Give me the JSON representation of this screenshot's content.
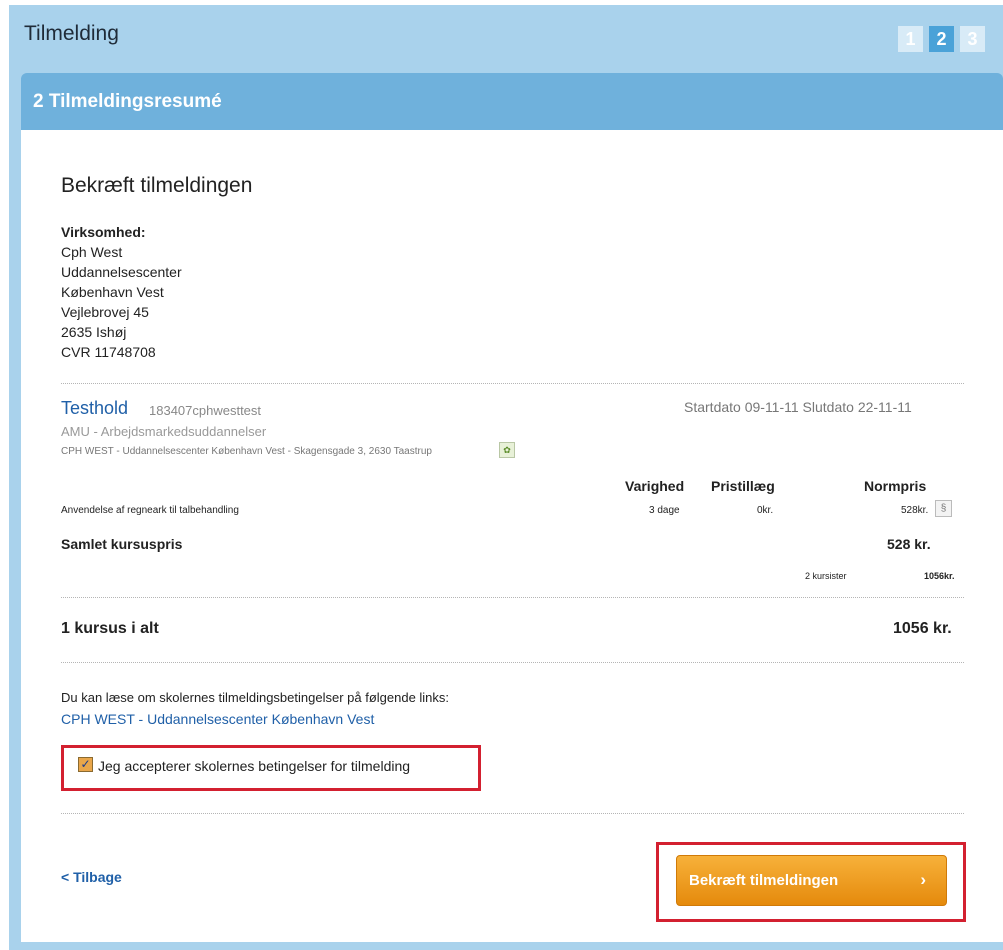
{
  "header": {
    "title": "Tilmelding",
    "steps": [
      "1",
      "2",
      "3"
    ],
    "active_step": 2
  },
  "section": {
    "title": "2 Tilmeldingsresumé"
  },
  "confirm_heading": "Bekræft tilmeldingen",
  "company": {
    "label": "Virksomhed:",
    "lines": [
      "Cph West",
      "Uddannelsescenter",
      "København Vest",
      "Vejlebrovej 45",
      "2635 Ishøj",
      "CVR 11748708"
    ]
  },
  "course": {
    "title": "Testhold",
    "code": "183407cphwesttest",
    "dates": "Startdato 09-11-11 Slutdato 22-11-11",
    "type": "AMU - Arbejdsmarkedsuddannelser",
    "location": "CPH WEST - Uddannelsescenter København Vest - Skagensgade 3, 2630 Taastrup",
    "columns": {
      "duration": "Varighed",
      "surcharge": "Pristillæg",
      "normprice": "Normpris"
    },
    "line_item": {
      "name": "Anvendelse af regneark til talbehandling",
      "duration": "3 dage",
      "surcharge": "0kr.",
      "price": "528kr."
    },
    "total_label": "Samlet kursuspris",
    "total_value": "528 kr.",
    "participants": "2 kursister",
    "participants_total": "1056kr."
  },
  "summary": {
    "label": "1 kursus i alt",
    "value": "1056 kr."
  },
  "terms": {
    "info": "Du kan læse om skolernes tilmeldingsbetingelser på følgende links:",
    "link": "CPH WEST - Uddannelsescenter København Vest",
    "accept_label": "Jeg accepterer skolernes betingelser for tilmelding",
    "accept_checked": true
  },
  "nav": {
    "back": "< Tilbage",
    "confirm": "Bekræft tilmeldingen",
    "confirm_chevron": "›"
  },
  "colors": {
    "accent_blue": "#6fb1dc",
    "button_orange": "#f29a1f",
    "highlight_red": "#d32030"
  }
}
